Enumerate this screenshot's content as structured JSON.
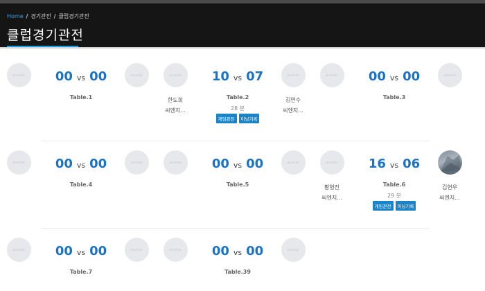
{
  "breadcrumb": {
    "home": "Home",
    "sep": "/",
    "level2": "경기관전",
    "level3": "클럽경기관전"
  },
  "page_title": "클럽경기관전",
  "avatar_placeholder": "avatar",
  "vs_label": "vs",
  "buttons": {
    "watch": "게임관전",
    "history": "이닝기록"
  },
  "colors": {
    "accent": "#1ba0e2",
    "score": "#1a73c4",
    "header_bg": "#151515",
    "button_bg": "#1a84c7"
  },
  "matches": [
    {
      "table": "Table.1",
      "left_score": "00",
      "right_score": "00"
    },
    {
      "table": "Table.2",
      "left_score": "10",
      "right_score": "07",
      "minutes": "28 분",
      "left_player": {
        "name": "한도희",
        "club": "씨엔지..."
      },
      "right_player": {
        "name": "김연수",
        "club": "씨엔지..."
      }
    },
    {
      "table": "Table.3",
      "left_score": "00",
      "right_score": "00"
    },
    {
      "table": "Table.4",
      "left_score": "00",
      "right_score": "00"
    },
    {
      "table": "Table.5",
      "left_score": "00",
      "right_score": "00"
    },
    {
      "table": "Table.6",
      "left_score": "16",
      "right_score": "06",
      "minutes": "29 분",
      "left_player": {
        "name": "황형진",
        "club": "씨엔지..."
      },
      "right_player": {
        "name": "김현우",
        "club": "씨엔지..."
      }
    },
    {
      "table": "Table.7",
      "left_score": "00",
      "right_score": "00"
    },
    {
      "table": "Table.39",
      "left_score": "00",
      "right_score": "00"
    }
  ]
}
